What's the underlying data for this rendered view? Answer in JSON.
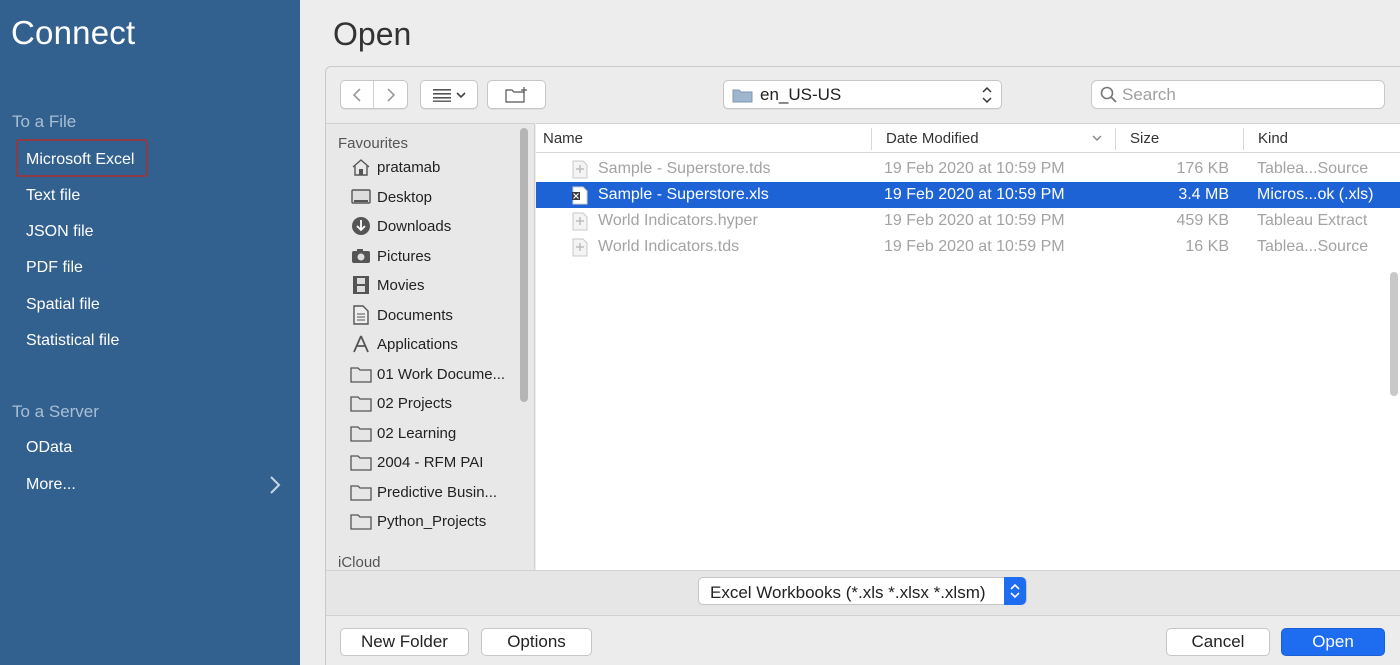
{
  "connect": {
    "title": "Connect",
    "file_section": "To a File",
    "file_items": [
      "Microsoft Excel",
      "Text file",
      "JSON file",
      "PDF file",
      "Spatial file",
      "Statistical file"
    ],
    "server_section": "To a Server",
    "server_items": [
      "OData",
      "More..."
    ]
  },
  "open": {
    "title": "Open",
    "location": "en_US-US",
    "search_placeholder": "Search"
  },
  "sidebar": {
    "favourites_label": "Favourites",
    "items": [
      {
        "label": "pratamab",
        "icon": "home-icon"
      },
      {
        "label": "Desktop",
        "icon": "desktop-icon"
      },
      {
        "label": "Downloads",
        "icon": "downloads-icon"
      },
      {
        "label": "Pictures",
        "icon": "camera-icon"
      },
      {
        "label": "Movies",
        "icon": "film-icon"
      },
      {
        "label": "Documents",
        "icon": "document-icon"
      },
      {
        "label": "Applications",
        "icon": "applications-icon"
      },
      {
        "label": "01 Work Docume...",
        "icon": "folder-icon"
      },
      {
        "label": "02 Projects",
        "icon": "folder-icon"
      },
      {
        "label": "02 Learning",
        "icon": "folder-icon"
      },
      {
        "label": "2004 - RFM PAI",
        "icon": "folder-icon"
      },
      {
        "label": "Predictive Busin...",
        "icon": "folder-icon"
      },
      {
        "label": "Python_Projects",
        "icon": "folder-icon"
      }
    ],
    "icloud_label": "iCloud"
  },
  "file_list": {
    "columns": {
      "name": "Name",
      "date": "Date Modified",
      "size": "Size",
      "kind": "Kind"
    },
    "rows": [
      {
        "name": "Sample - Superstore.tds",
        "date": "19 Feb 2020 at 10:59 PM",
        "size": "176 KB",
        "kind": "Tablea...Source",
        "selected": false
      },
      {
        "name": "Sample - Superstore.xls",
        "date": "19 Feb 2020 at 10:59 PM",
        "size": "3.4 MB",
        "kind": "Micros...ok (.xls)",
        "selected": true
      },
      {
        "name": "World Indicators.hyper",
        "date": "19 Feb 2020 at 10:59 PM",
        "size": "459 KB",
        "kind": "Tableau Extract",
        "selected": false
      },
      {
        "name": "World Indicators.tds",
        "date": "19 Feb 2020 at 10:59 PM",
        "size": "16 KB",
        "kind": "Tablea...Source",
        "selected": false
      }
    ]
  },
  "format": {
    "selected": "Excel Workbooks (*.xls *.xlsx *.xlsm)"
  },
  "buttons": {
    "new_folder": "New Folder",
    "options": "Options",
    "cancel": "Cancel",
    "open": "Open"
  },
  "colors": {
    "connect_bg": "#33618f",
    "selection": "#1e63d6",
    "primary_button": "#1e6cf0",
    "selected_item_border": "#8e3b44"
  }
}
